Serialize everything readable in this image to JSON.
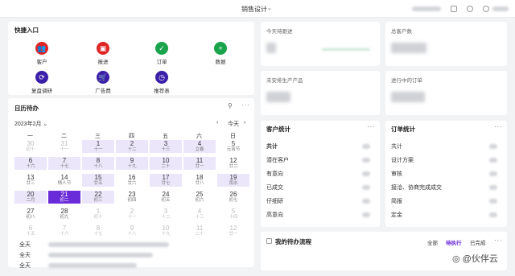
{
  "topbar": {
    "title": "销售设计",
    "chevron": "⌄"
  },
  "quick": {
    "title": "快捷入口",
    "items": [
      {
        "label": "客户",
        "icon": "users-icon",
        "glyph": "👥",
        "color": "#e02424"
      },
      {
        "label": "报进",
        "icon": "present-icon",
        "glyph": "▣",
        "color": "#e02424"
      },
      {
        "label": "订单",
        "icon": "calendar-check-icon",
        "glyph": "✓",
        "color": "#19a34a"
      },
      {
        "label": "数据",
        "icon": "plus-icon",
        "glyph": "+",
        "color": "#19a34a"
      },
      {
        "label": "复盘调研",
        "icon": "sync-icon",
        "glyph": "⟳",
        "color": "#3b1fa8"
      },
      {
        "label": "广告费",
        "icon": "cart-icon",
        "glyph": "🛒",
        "color": "#3b1fa8"
      },
      {
        "label": "推荐表",
        "icon": "clock-icon",
        "glyph": "◷",
        "color": "#3b1fa8"
      }
    ]
  },
  "schedule": {
    "title": "日历待办",
    "month": "2023年2月",
    "today_label": "今天",
    "weekdays": [
      "一",
      "二",
      "三",
      "四",
      "五",
      "六",
      "日"
    ],
    "weeks": [
      [
        {
          "d": "30",
          "l": "初十",
          "f": true
        },
        {
          "d": "31",
          "l": "十一",
          "f": true
        },
        {
          "d": "1",
          "l": "十一",
          "h": true
        },
        {
          "d": "2",
          "l": "十二",
          "h": true
        },
        {
          "d": "3",
          "l": "十三",
          "h": true
        },
        {
          "d": "4",
          "l": "立春",
          "h": true
        },
        {
          "d": "5",
          "l": "元宵节"
        }
      ],
      [
        {
          "d": "6",
          "l": "十六",
          "h": true
        },
        {
          "d": "7",
          "l": "十七",
          "h": true
        },
        {
          "d": "8",
          "l": "十八",
          "h": true
        },
        {
          "d": "9",
          "l": "十九",
          "h": true
        },
        {
          "d": "10",
          "l": "二十",
          "h": true
        },
        {
          "d": "11",
          "l": "廿一",
          "h": true
        },
        {
          "d": "12",
          "l": "廿二"
        }
      ],
      [
        {
          "d": "13",
          "l": "廿三"
        },
        {
          "d": "14",
          "l": "情人节"
        },
        {
          "d": "15",
          "l": "廿五",
          "h": true
        },
        {
          "d": "16",
          "l": "廿六"
        },
        {
          "d": "17",
          "l": "廿七",
          "h": true
        },
        {
          "d": "18",
          "l": "廿八"
        },
        {
          "d": "19",
          "l": "雨水",
          "h": true
        }
      ],
      [
        {
          "d": "20",
          "l": "二月",
          "h": true
        },
        {
          "d": "21",
          "l": "初二",
          "t": true
        },
        {
          "d": "22",
          "l": "初三",
          "h": true
        },
        {
          "d": "23",
          "l": "初四"
        },
        {
          "d": "24",
          "l": "初五"
        },
        {
          "d": "25",
          "l": "初六"
        },
        {
          "d": "26",
          "l": "初七"
        }
      ],
      [
        {
          "d": "27",
          "l": "初八"
        },
        {
          "d": "28",
          "l": "初九"
        },
        {
          "d": "1",
          "l": "初十",
          "f": true
        },
        {
          "d": "2",
          "l": "十一",
          "f": true
        },
        {
          "d": "3",
          "l": "十二",
          "f": true
        },
        {
          "d": "4",
          "l": "十三",
          "f": true
        },
        {
          "d": "5",
          "l": "十四",
          "f": true
        }
      ],
      [
        {
          "d": "6",
          "l": "十五",
          "f": true
        },
        {
          "d": "7",
          "l": "十六",
          "f": true
        },
        {
          "d": "8",
          "l": "十七",
          "f": true
        },
        {
          "d": "9",
          "l": "十八",
          "f": true
        },
        {
          "d": "10",
          "l": "十九",
          "f": true
        },
        {
          "d": "11",
          "l": "二十",
          "f": true
        },
        {
          "d": "12",
          "l": "廿一",
          "f": true
        }
      ]
    ],
    "todo_rows": [
      {
        "label": "全天"
      },
      {
        "label": "全天"
      },
      {
        "label": "全天"
      }
    ]
  },
  "stats": [
    {
      "label": "今天待跟进"
    },
    {
      "label": "总客户数"
    },
    {
      "label": "未安排生产产品"
    },
    {
      "label": "进行中的订单"
    }
  ],
  "customer_stats": {
    "title": "客户统计",
    "rows": [
      {
        "label": "共计",
        "bold": true
      },
      {
        "label": "潜在客户"
      },
      {
        "label": "有意向"
      },
      {
        "label": "已成交"
      },
      {
        "label": "仔细研"
      },
      {
        "label": "高意向"
      }
    ]
  },
  "order_stats": {
    "title": "订单统计",
    "rows": [
      {
        "label": "共计"
      },
      {
        "label": "设计方案"
      },
      {
        "label": "审核"
      },
      {
        "label": "接洽、协商完成成交"
      },
      {
        "label": "简报"
      },
      {
        "label": "定金"
      }
    ]
  },
  "workflow": {
    "title": "我的待办流程",
    "tabs": [
      {
        "label": "全部"
      },
      {
        "label": "待执行",
        "active": true
      },
      {
        "label": "已完成"
      }
    ]
  },
  "watermark": "◎ @伙伴云",
  "colors": {
    "accent": "#6a2bd9",
    "highlight": "#ece6fb",
    "red": "#e02424",
    "green": "#19a34a",
    "navy": "#3b1fa8"
  }
}
